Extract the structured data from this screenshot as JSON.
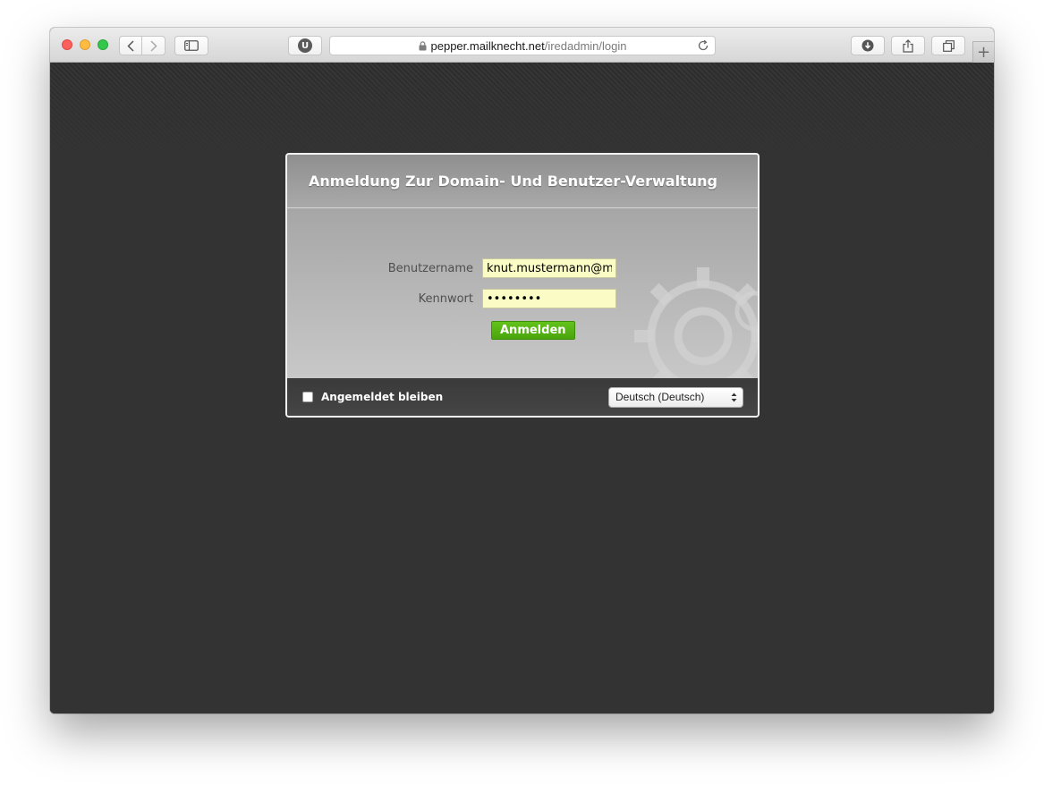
{
  "browser": {
    "url_domain": "pepper.mailknecht.net",
    "url_path": "/iredadmin/login",
    "extension_badge": "U",
    "new_tab_label": "+"
  },
  "login": {
    "title": "Anmeldung Zur Domain- Und Benutzer-Verwaltung",
    "username_label": "Benutzername",
    "username_value": "knut.mustermann@me",
    "password_label": "Kennwort",
    "password_value": "••••••••",
    "submit_label": "Anmelden",
    "remember_label": "Angemeldet bleiben",
    "language_selected": "Deutsch (Deutsch)"
  },
  "colors": {
    "page_background": "#333333",
    "submit_green": "#4aa50c",
    "input_yellow": "#fbfbc5"
  },
  "icons": [
    "back-arrow-icon",
    "forward-arrow-icon",
    "sidebar-icon",
    "lock-icon",
    "reload-icon",
    "download-icon",
    "share-icon",
    "tabs-icon",
    "gear-icon"
  ]
}
